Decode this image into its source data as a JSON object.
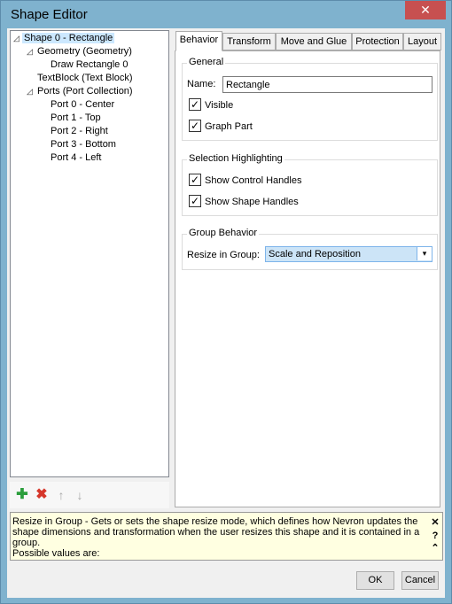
{
  "window": {
    "title": "Shape Editor",
    "close_glyph": "✕"
  },
  "tree": {
    "nodes": [
      {
        "label": "Shape 0 - Rectangle",
        "expander": "◿",
        "selected": true
      },
      {
        "label": "Geometry (Geometry)",
        "expander": "◿"
      },
      {
        "label": "Draw Rectangle 0"
      },
      {
        "label": "TextBlock (Text Block)"
      },
      {
        "label": "Ports (Port Collection)",
        "expander": "◿"
      },
      {
        "label": "Port 0 - Center"
      },
      {
        "label": "Port 1 - Top"
      },
      {
        "label": "Port 2 - Right"
      },
      {
        "label": "Port 3 - Bottom"
      },
      {
        "label": "Port 4 - Left"
      }
    ]
  },
  "toolbar": {
    "add_glyph": "✚",
    "delete_glyph": "✖",
    "up_glyph": "↑",
    "down_glyph": "↓",
    "icons": [
      "add-icon",
      "delete-icon",
      "move-up-icon",
      "move-down-icon"
    ]
  },
  "tabs": [
    "Behavior",
    "Transform",
    "Move and Glue",
    "Protection",
    "Layout"
  ],
  "general": {
    "title": "General",
    "name_label": "Name:",
    "name_value": "Rectangle",
    "visible_label": "Visible",
    "visible_checked": true,
    "graph_part_label": "Graph Part",
    "graph_part_checked": true
  },
  "selection": {
    "title": "Selection Highlighting",
    "control_handles_label": "Show Control Handles",
    "control_handles_checked": true,
    "shape_handles_label": "Show Shape Handles",
    "shape_handles_checked": true
  },
  "group_behavior": {
    "title": "Group Behavior",
    "resize_label": "Resize in Group:",
    "resize_value": "Scale and Reposition"
  },
  "help": {
    "text1": "Resize in Group - Gets or sets the shape resize mode, which defines how Nevron updates the shape dimensions and transformation when the user resizes this shape and it is contained in a group.",
    "text2": "Possible values are:",
    "close_glyph": "✕",
    "question_glyph": "?",
    "collapse_glyph": "⌃"
  },
  "buttons": {
    "ok": "OK",
    "cancel": "Cancel"
  },
  "colors": {
    "title_bar": "#7fb2ce",
    "close": "#c75050",
    "selection": "#cce8ff",
    "help_bg": "#ffffe1"
  }
}
